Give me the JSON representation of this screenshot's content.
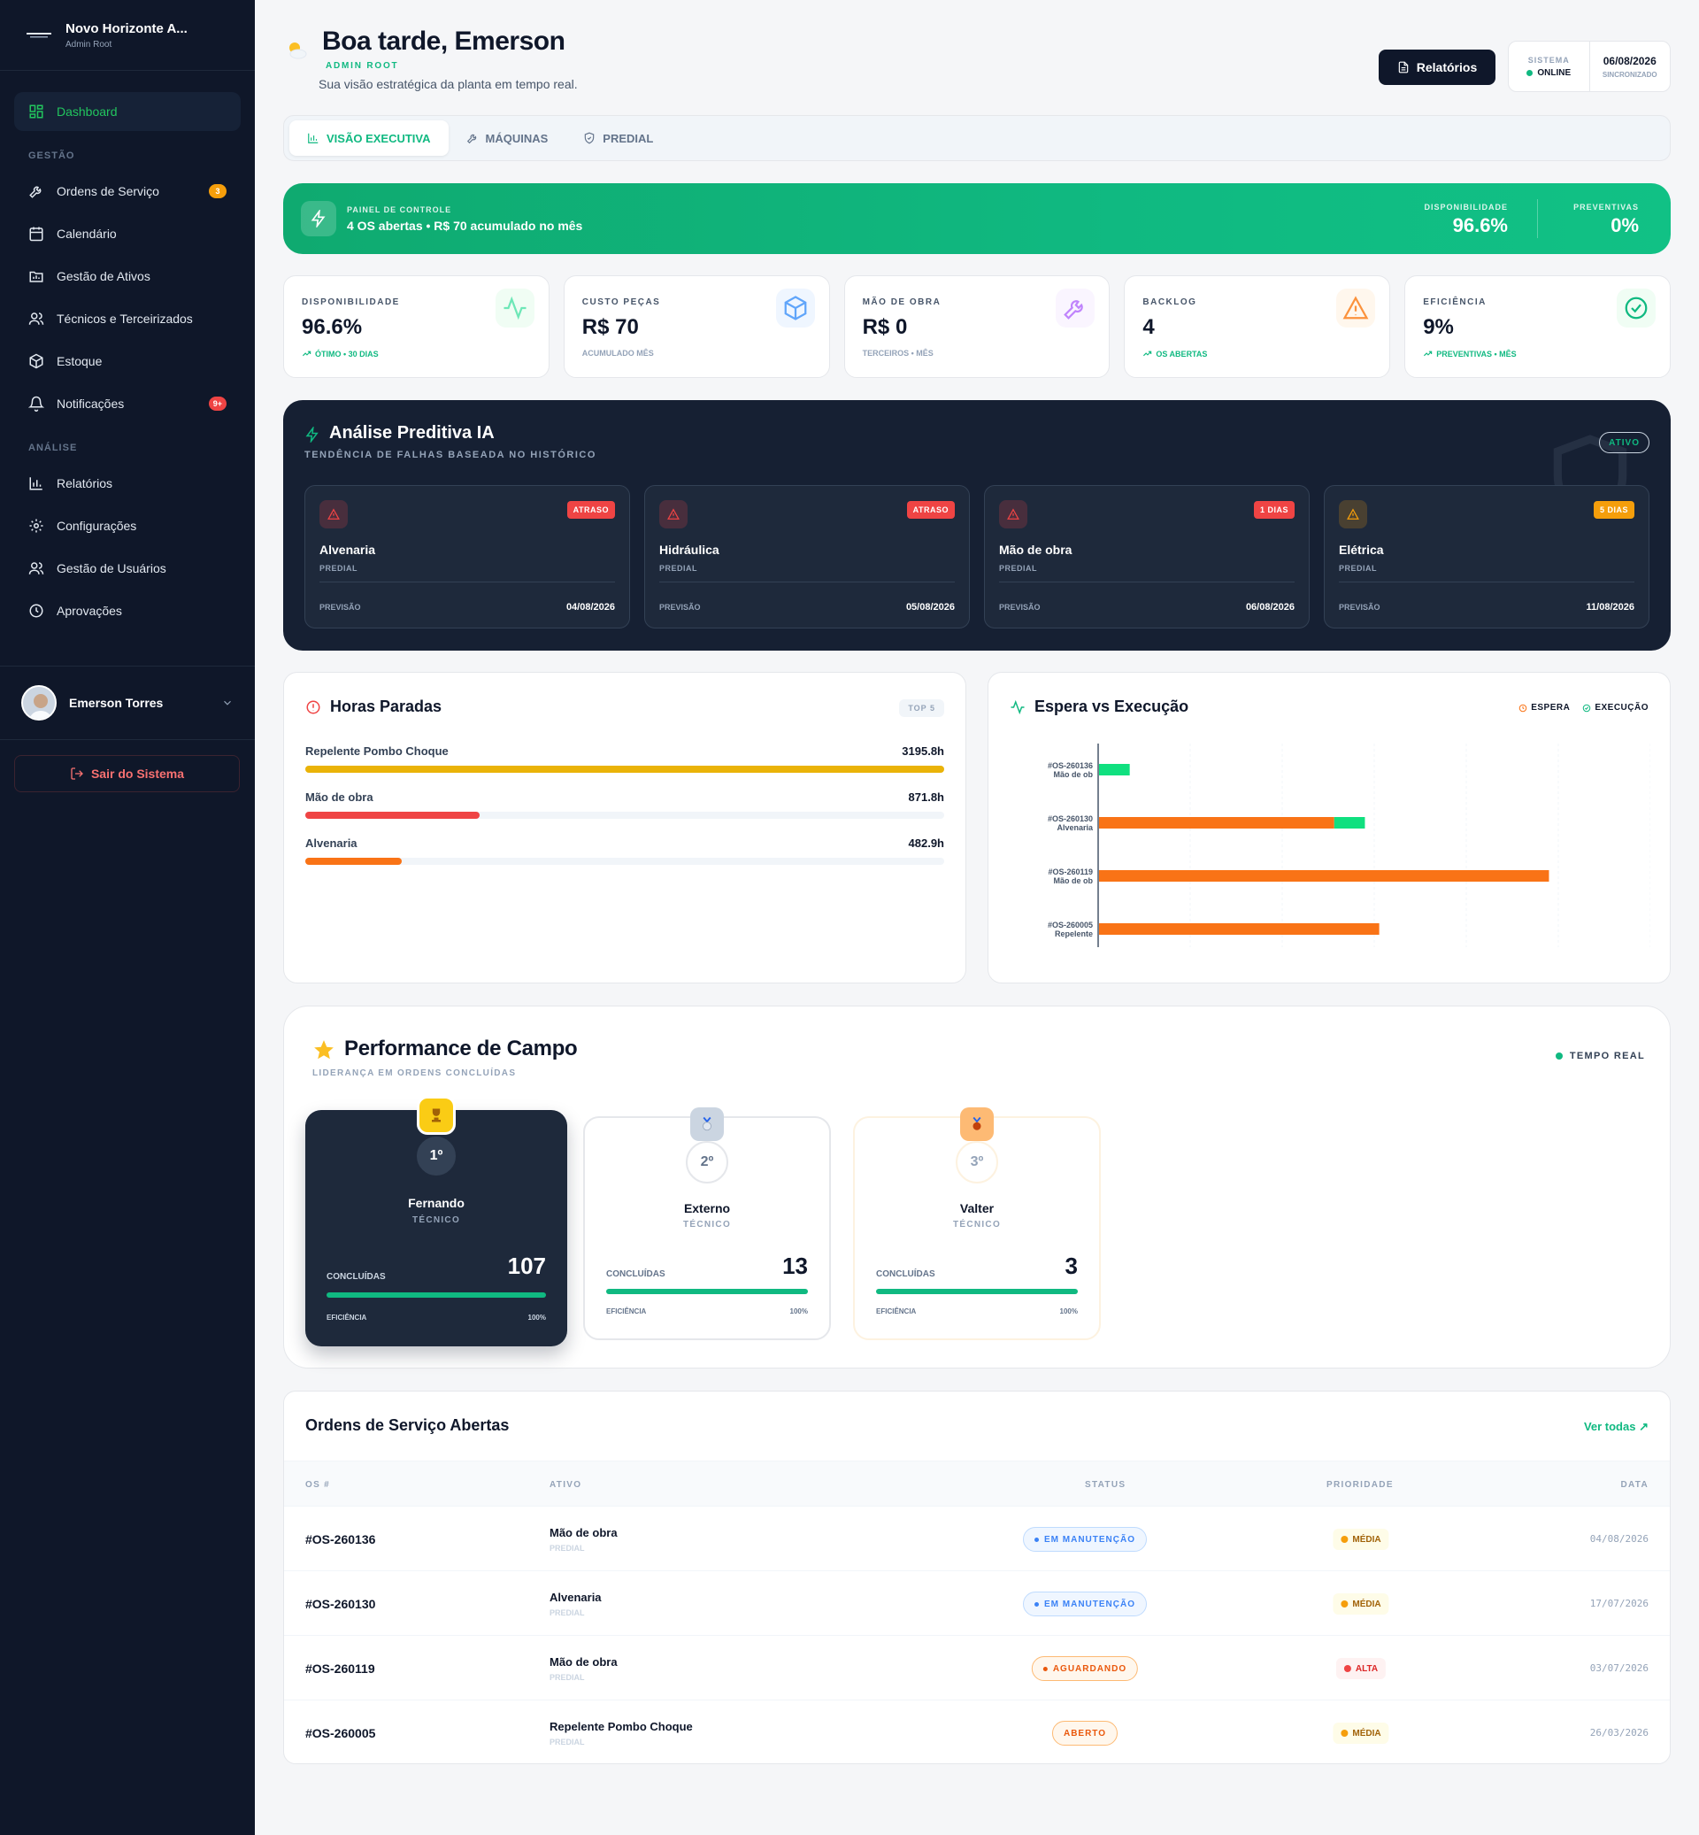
{
  "sidebar": {
    "brand_name": "Novo Horizonte A...",
    "brand_sub": "Admin Root",
    "dashboard": "Dashboard",
    "section_gestao": "GESTÃO",
    "items_gestao": [
      {
        "label": "Ordens de Serviço",
        "badge": "3"
      },
      {
        "label": "Calendário"
      },
      {
        "label": "Gestão de Ativos"
      },
      {
        "label": "Técnicos e Terceirizados"
      },
      {
        "label": "Estoque"
      },
      {
        "label": "Notificações",
        "badge": "9+"
      }
    ],
    "section_analise": "ANÁLISE",
    "items_analise": [
      {
        "label": "Relatórios"
      },
      {
        "label": "Configurações"
      },
      {
        "label": "Gestão de Usuários"
      },
      {
        "label": "Aprovações"
      }
    ],
    "user_name": "Emerson Torres",
    "logout": "Sair do Sistema"
  },
  "header": {
    "title": "Boa tarde, Emerson",
    "role": "ADMIN ROOT",
    "subtitle": "Sua visão estratégica da planta em tempo real.",
    "reports_button": "Relatórios",
    "system_label": "SISTEMA",
    "system_status": "ONLINE",
    "date": "06/08/2026",
    "sync": "SINCRONIZADO"
  },
  "tabs": [
    "VISÃO EXECUTIVA",
    "MÁQUINAS",
    "PREDIAL"
  ],
  "banner": {
    "label": "PAINEL DE CONTROLE",
    "text": "4 OS abertas • R$ 70 acumulado no mês",
    "stat1_label": "DISPONIBILIDADE",
    "stat1_value": "96.6%",
    "stat2_label": "PREVENTIVAS",
    "stat2_value": "0%"
  },
  "kpis": [
    {
      "label": "DISPONIBILIDADE",
      "value": "96.6%",
      "sub": "ÓTIMO • 30 DIAS"
    },
    {
      "label": "CUSTO PEÇAS",
      "value": "R$ 70",
      "sub": "ACUMULADO MÊS"
    },
    {
      "label": "MÃO DE OBRA",
      "value": "R$ 0",
      "sub": "TERCEIROS • MÊS"
    },
    {
      "label": "BACKLOG",
      "value": "4",
      "sub": "OS ABERTAS"
    },
    {
      "label": "EFICIÊNCIA",
      "value": "9%",
      "sub": "PREVENTIVAS • MÊS"
    }
  ],
  "ai": {
    "title": "Análise Preditiva IA",
    "subtitle": "TENDÊNCIA DE FALHAS BASEADA NO HISTÓRICO",
    "badge": "ATIVO",
    "forecast_label": "PREVISÃO",
    "cards": [
      {
        "name": "Alvenaria",
        "category": "PREDIAL",
        "tag": "ATRASO",
        "date": "04/08/2026",
        "tag_color": "#ef4444"
      },
      {
        "name": "Hidráulica",
        "category": "PREDIAL",
        "tag": "ATRASO",
        "date": "05/08/2026",
        "tag_color": "#ef4444"
      },
      {
        "name": "Mão de obra",
        "category": "PREDIAL",
        "tag": "1 DIAS",
        "date": "06/08/2026",
        "tag_color": "#ef4444"
      },
      {
        "name": "Elétrica",
        "category": "PREDIAL",
        "tag": "5 DIAS",
        "date": "11/08/2026",
        "tag_color": "#f59e0b"
      }
    ]
  },
  "horas_paradas": {
    "title": "Horas Paradas",
    "badge": "TOP 5",
    "rows": [
      {
        "name": "Repelente Pombo Choque",
        "value": "3195.8h",
        "hours": 3195.8,
        "color": "#eab308"
      },
      {
        "name": "Mão de obra",
        "value": "871.8h",
        "hours": 871.8,
        "color": "#ef4444"
      },
      {
        "name": "Alvenaria",
        "value": "482.9h",
        "hours": 482.9,
        "color": "#f97316"
      }
    ]
  },
  "espera_exec": {
    "title": "Espera vs Execução",
    "legend_espera": "ESPERA",
    "legend_execucao": "EXECUÇÃO"
  },
  "chart_data": {
    "type": "bar",
    "orientation": "horizontal",
    "stacked": true,
    "title": "Espera vs Execução",
    "categories": [
      {
        "id": "#OS-260136",
        "sub": "Mão de ob"
      },
      {
        "id": "#OS-260130",
        "sub": "Alvenaria"
      },
      {
        "id": "#OS-260119",
        "sub": "Mão de ob"
      },
      {
        "id": "#OS-260005",
        "sub": "Repelente"
      }
    ],
    "series": [
      {
        "name": "ESPERA",
        "color": "#f97316",
        "values": [
          0,
          230,
          440,
          274
        ]
      },
      {
        "name": "EXECUÇÃO",
        "color": "#10e07f",
        "values": [
          30,
          30,
          0,
          0
        ]
      }
    ],
    "xlim": [
      0,
      540
    ],
    "grid": true,
    "legend": "top-right"
  },
  "performance": {
    "title": "Performance de Campo",
    "subtitle": "LIDERANÇA EM ORDENS CONCLUÍDAS",
    "live": "TEMPO REAL",
    "completed_label": "CONCLUÍDAS",
    "efficiency_label": "EFICIÊNCIA",
    "ranking": [
      {
        "pos": "1º",
        "name": "Fernando",
        "role": "TÉCNICO",
        "count": "107",
        "efficiency": "100%",
        "efficiency_value": 1.0
      },
      {
        "pos": "2º",
        "name": "Externo",
        "role": "TÉCNICO",
        "count": "13",
        "efficiency": "100%",
        "efficiency_value": 1.0
      },
      {
        "pos": "3º",
        "name": "Valter",
        "role": "TÉCNICO",
        "count": "3",
        "efficiency": "100%",
        "efficiency_value": 1.0
      }
    ]
  },
  "orders": {
    "title": "Ordens de Serviço Abertas",
    "view_all": "Ver todas",
    "columns": [
      "OS #",
      "ATIVO",
      "STATUS",
      "PRIORIDADE",
      "DATA"
    ],
    "rows": [
      {
        "id": "#OS-260136",
        "asset": "Mão de obra",
        "category": "PREDIAL",
        "status": "EM MANUTENÇÃO",
        "priority": "MÉDIA",
        "date": "04/08/2026"
      },
      {
        "id": "#OS-260130",
        "asset": "Alvenaria",
        "category": "PREDIAL",
        "status": "EM MANUTENÇÃO",
        "priority": "MÉDIA",
        "date": "17/07/2026"
      },
      {
        "id": "#OS-260119",
        "asset": "Mão de obra",
        "category": "PREDIAL",
        "status": "AGUARDANDO",
        "priority": "ALTA",
        "date": "03/07/2026"
      },
      {
        "id": "#OS-260005",
        "asset": "Repelente Pombo Choque",
        "category": "PREDIAL",
        "status": "ABERTO",
        "priority": "MÉDIA",
        "date": "26/03/2026"
      }
    ]
  }
}
